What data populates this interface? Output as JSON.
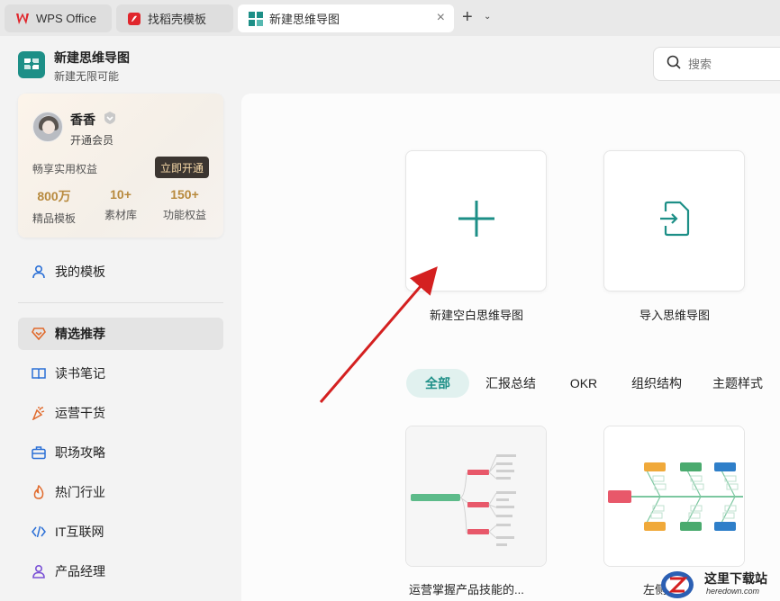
{
  "tabs": [
    {
      "label": "WPS Office",
      "icon": "wps-logo-icon"
    },
    {
      "label": "找稻壳模板",
      "icon": "docer-logo-icon"
    },
    {
      "label": "新建思维导图",
      "icon": "mindmap-logo-icon",
      "active": true
    }
  ],
  "header": {
    "title": "新建思维导图",
    "subtitle": "新建无限可能",
    "search_placeholder": "搜索"
  },
  "member": {
    "name": "香香",
    "status": "开通会员",
    "benefit_text": "畅享实用权益",
    "open_button": "立即开通",
    "stats": [
      {
        "value": "800万",
        "label": "精品模板"
      },
      {
        "value": "10+",
        "label": "素材库"
      },
      {
        "value": "150+",
        "label": "功能权益"
      }
    ]
  },
  "sidebar": {
    "my_templates": "我的模板",
    "items": [
      {
        "label": "精选推荐",
        "icon": "diamond-icon",
        "active": true
      },
      {
        "label": "读书笔记",
        "icon": "book-icon"
      },
      {
        "label": "运营干货",
        "icon": "party-popper-icon"
      },
      {
        "label": "职场攻略",
        "icon": "briefcase-icon"
      },
      {
        "label": "热门行业",
        "icon": "flame-icon"
      },
      {
        "label": "IT互联网",
        "icon": "code-icon"
      },
      {
        "label": "产品经理",
        "icon": "user-icon"
      }
    ]
  },
  "actions": {
    "new_blank": "新建空白思维导图",
    "import": "导入思维导图"
  },
  "categories": [
    "全部",
    "汇报总结",
    "OKR",
    "组织结构",
    "主题样式"
  ],
  "templates": [
    {
      "title": "运营掌握产品技能的..."
    },
    {
      "title": "左侧"
    }
  ],
  "watermark": {
    "name": "这里下载站",
    "url": "heredown.com"
  },
  "colors": {
    "accent": "#1d8f87",
    "arrow": "#d42020",
    "gold": "#b88a3e"
  }
}
